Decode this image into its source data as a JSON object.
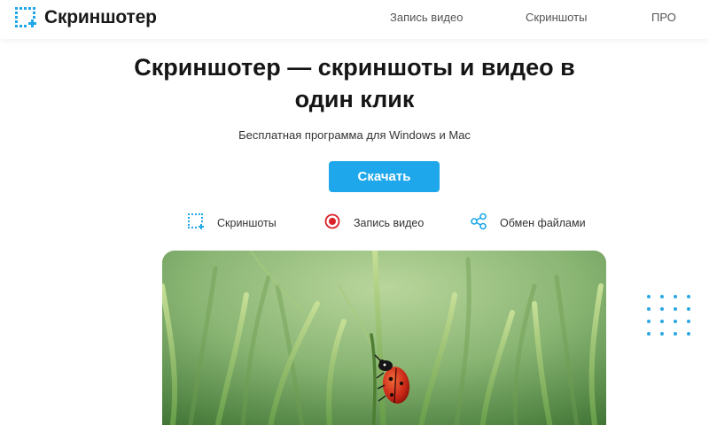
{
  "header": {
    "logo_text": "Скриншотер",
    "nav": [
      {
        "label": "Запись видео"
      },
      {
        "label": "Скриншоты"
      },
      {
        "label": "ПРО"
      }
    ]
  },
  "hero": {
    "title_line1": "Скриншотер — скриншоты и видео в",
    "title_line2": "один клик",
    "subtitle": "Бесплатная программа для Windows и Mac",
    "download_label": "Скачать"
  },
  "features": [
    {
      "label": "Скриншоты",
      "icon": "screenshot-icon"
    },
    {
      "label": "Запись видео",
      "icon": "record-icon"
    },
    {
      "label": "Обмен файлами",
      "icon": "share-icon"
    }
  ],
  "image": {
    "subject": "ladybug-on-grass"
  },
  "colors": {
    "accent": "#1ea7ea",
    "record": "#d9222a",
    "text": "#151515"
  }
}
